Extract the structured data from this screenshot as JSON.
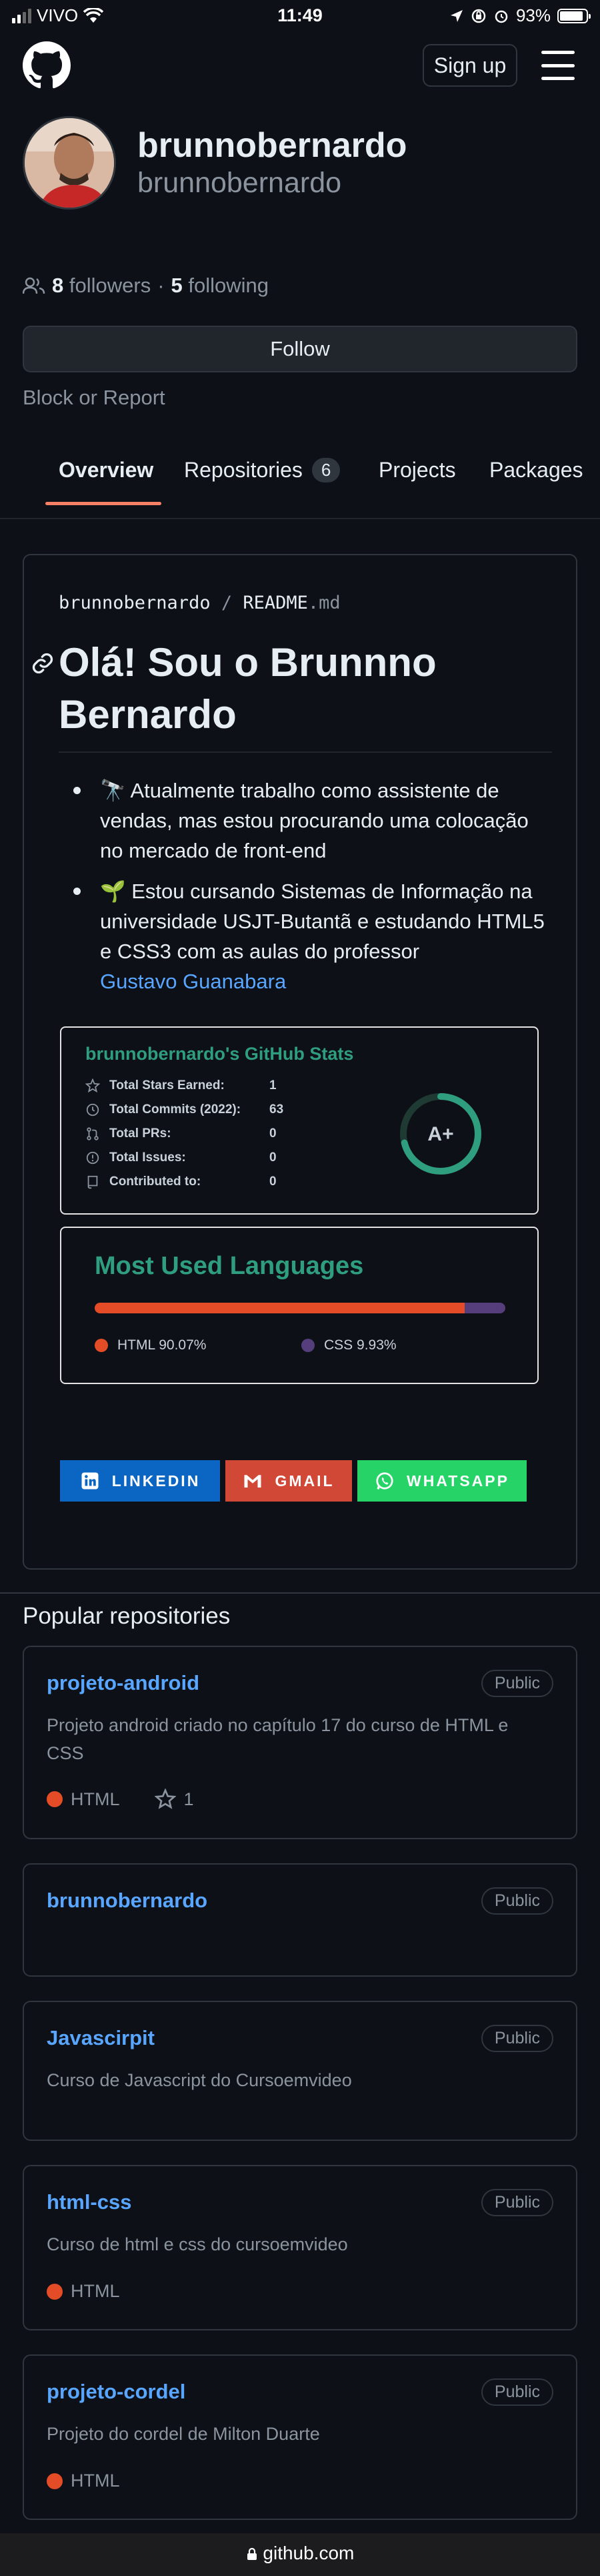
{
  "status_bar": {
    "carrier": "VIVO",
    "time": "11:49",
    "battery": "93%"
  },
  "header": {
    "signup_label": "Sign up"
  },
  "profile": {
    "name": "brunnobernardo",
    "login": "brunnobernardo",
    "followers_count": "8",
    "followers_label": "followers",
    "separator": "·",
    "following_count": "5",
    "following_label": "following",
    "follow_label": "Follow",
    "block_label": "Block or Report"
  },
  "tabs": [
    {
      "label": "Overview",
      "active": true
    },
    {
      "label": "Repositories",
      "count": "6"
    },
    {
      "label": "Projects"
    },
    {
      "label": "Packages"
    }
  ],
  "readme": {
    "path_user": "brunnobernardo",
    "path_sep": "/",
    "path_file": "README",
    "path_ext": ".md",
    "heading": "Olá! Sou o Brunnno Bernardo",
    "bullets": [
      {
        "text": "🔭 Atualmente trabalho como assistente de vendas, mas estou procurando uma colocação no mercado de front-end"
      },
      {
        "text": "🌱 Estou cursando Sistemas de Informação na universidade USJT-Butantã e estudando HTML5 e CSS3 com as aulas do professor",
        "link": "Gustavo Guanabara"
      }
    ],
    "stats_card": {
      "title": "brunnobernardo's GitHub Stats",
      "rows": [
        {
          "label": "Total Stars Earned:",
          "value": "1",
          "icon": "star-icon"
        },
        {
          "label": "Total Commits (2022):",
          "value": "63",
          "icon": "history-icon"
        },
        {
          "label": "Total PRs:",
          "value": "0",
          "icon": "pull-request-icon"
        },
        {
          "label": "Total Issues:",
          "value": "0",
          "icon": "issue-icon"
        },
        {
          "label": "Contributed to:",
          "value": "0",
          "icon": "repo-icon"
        }
      ],
      "grade": "A+",
      "accent": "#2f9e7f"
    },
    "languages_card": {
      "title": "Most Used Languages",
      "languages": [
        {
          "name": "HTML",
          "percent_label": "90.07%",
          "percent": 90.07,
          "color": "#e34c26"
        },
        {
          "name": "CSS",
          "percent_label": "9.93%",
          "percent": 9.93,
          "color": "#563d7c"
        }
      ]
    },
    "badges": [
      {
        "label": "LINKEDIN",
        "color": "#0a66c2",
        "icon": "linkedin-icon"
      },
      {
        "label": "GMAIL",
        "color": "#d14836",
        "icon": "gmail-icon"
      },
      {
        "label": "WHATSAPP",
        "color": "#25d366",
        "icon": "whatsapp-icon"
      }
    ]
  },
  "popular": {
    "title": "Popular repositories",
    "repos": [
      {
        "name": "projeto-android",
        "visibility": "Public",
        "description": "Projeto android criado no capítulo 17 do curso de HTML e CSS",
        "language": "HTML",
        "stars": "1"
      },
      {
        "name": "brunnobernardo",
        "visibility": "Public",
        "description": ""
      },
      {
        "name": "Javascirpit",
        "visibility": "Public",
        "description": "Curso de Javascript do Cursoemvideo"
      },
      {
        "name": "html-css",
        "visibility": "Public",
        "description": "Curso de html e css do cursoemvideo",
        "language": "HTML"
      },
      {
        "name": "projeto-cordel",
        "visibility": "Public",
        "description": "Projeto do cordel de Milton Duarte",
        "language": "HTML"
      }
    ]
  },
  "browser": {
    "url": "github.com"
  },
  "colors": {
    "background": "#0d1117",
    "link": "#58a6ff",
    "border": "#30363d",
    "tab_underline": "#f78166",
    "html_lang": "#e34c26"
  }
}
